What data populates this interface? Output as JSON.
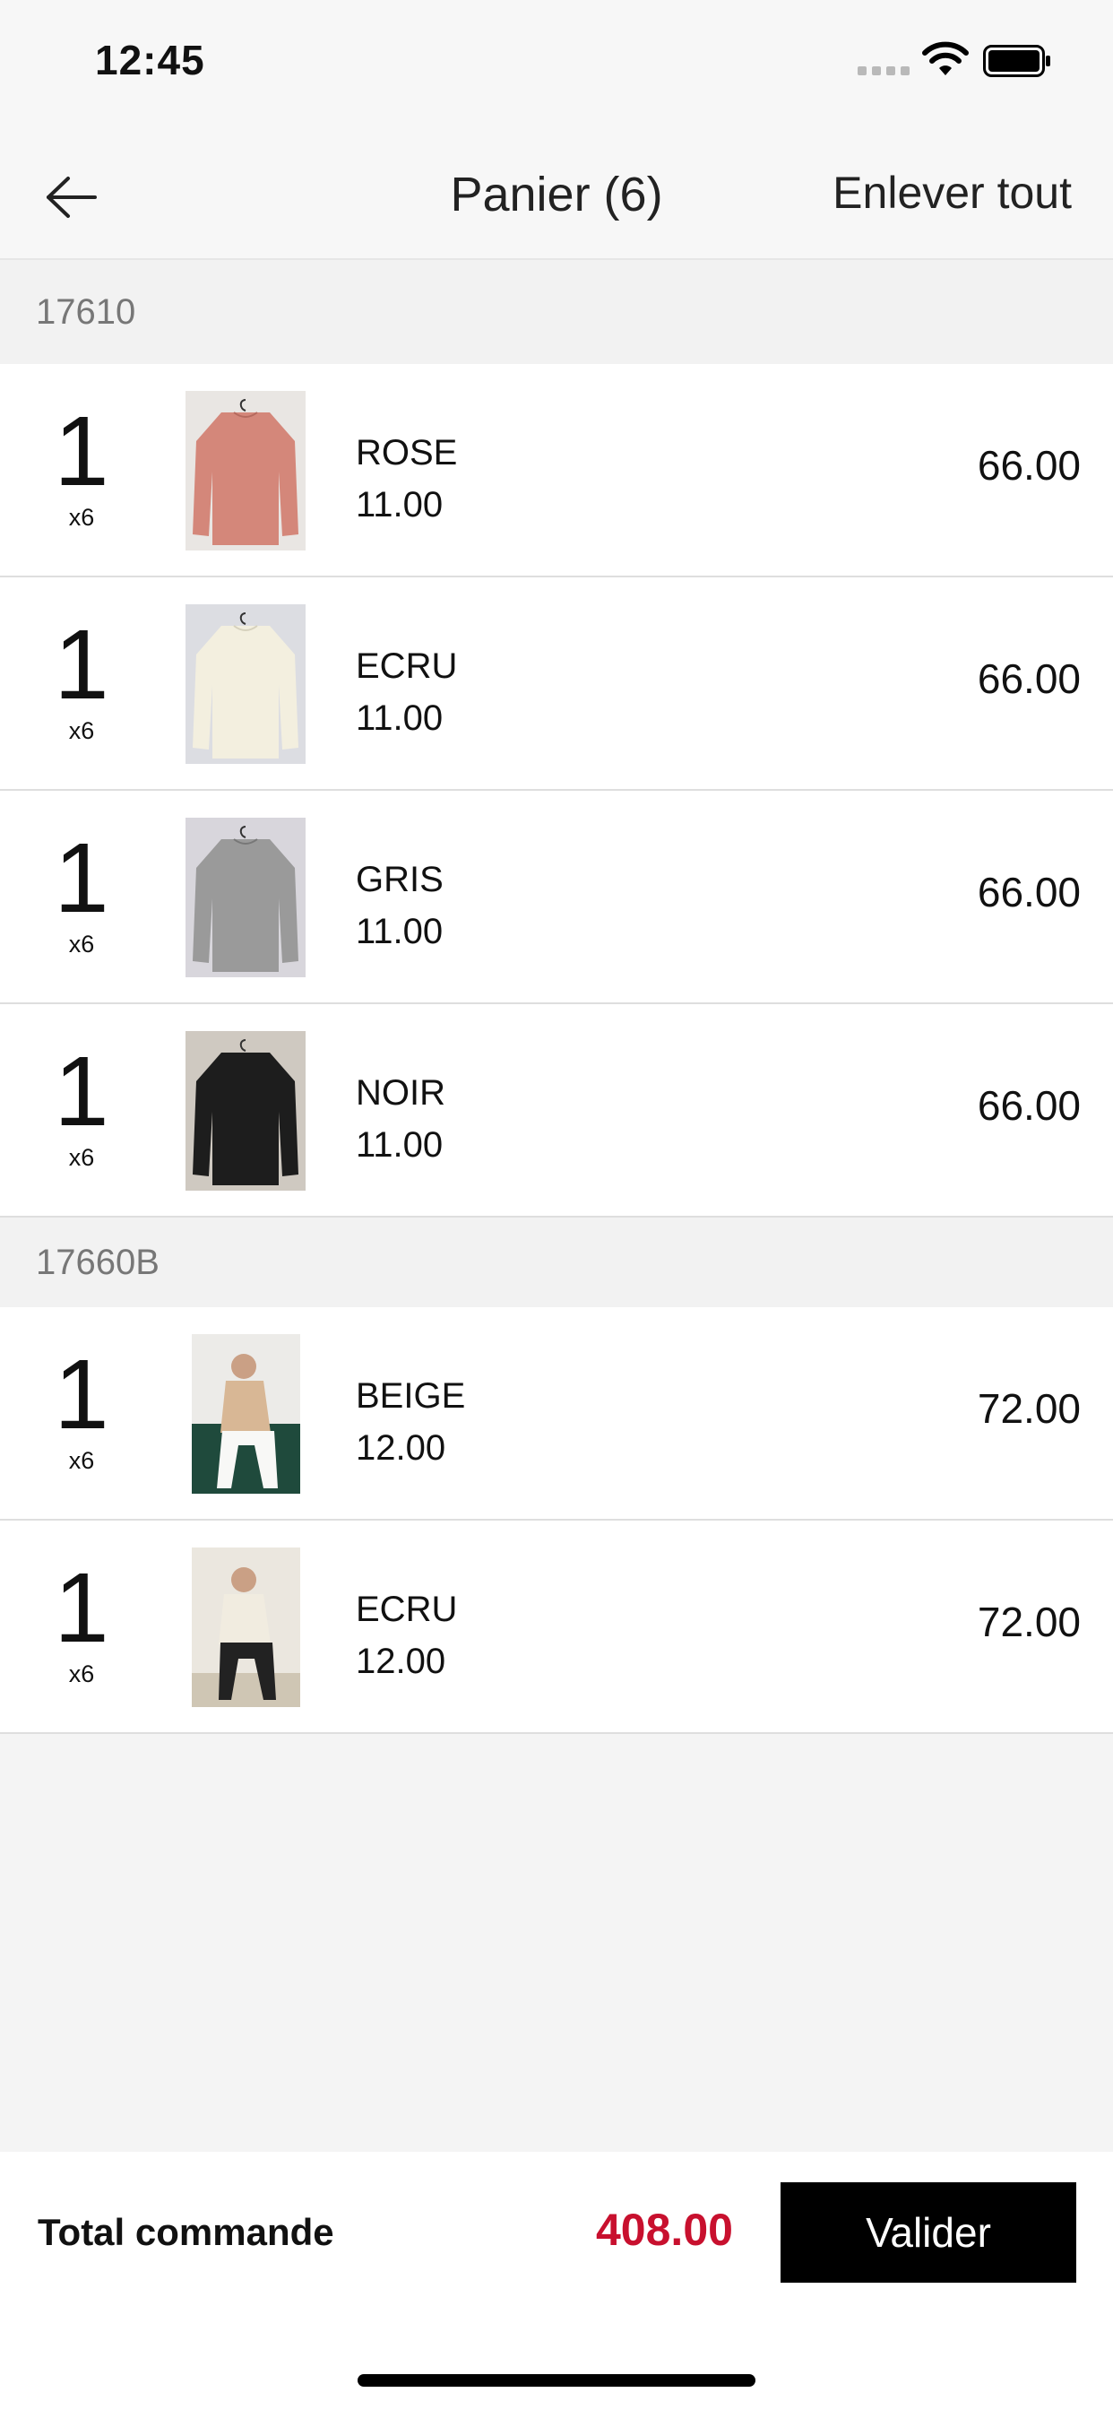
{
  "status_bar": {
    "time": "12:45"
  },
  "nav": {
    "title": "Panier (6)",
    "action_label": "Enlever tout"
  },
  "groups": [
    {
      "ref": "17610",
      "items": [
        {
          "qty": "1",
          "multiplier": "x6",
          "color_name": "ROSE",
          "unit_price": "11.00",
          "line_total": "66.00",
          "swatch": "#d4877a"
        },
        {
          "qty": "1",
          "multiplier": "x6",
          "color_name": "ECRU",
          "unit_price": "11.00",
          "line_total": "66.00",
          "swatch": "#f3efdf"
        },
        {
          "qty": "1",
          "multiplier": "x6",
          "color_name": "GRIS",
          "unit_price": "11.00",
          "line_total": "66.00",
          "swatch": "#9a9a9a"
        },
        {
          "qty": "1",
          "multiplier": "x6",
          "color_name": "NOIR",
          "unit_price": "11.00",
          "line_total": "66.00",
          "swatch": "#1d1d1d"
        }
      ]
    },
    {
      "ref": "17660B",
      "items": [
        {
          "qty": "1",
          "multiplier": "x6",
          "color_name": "BEIGE",
          "unit_price": "12.00",
          "line_total": "72.00",
          "swatch": "#d8b795"
        },
        {
          "qty": "1",
          "multiplier": "x6",
          "color_name": "ECRU",
          "unit_price": "12.00",
          "line_total": "72.00",
          "swatch": "#f1ece0"
        }
      ]
    }
  ],
  "footer": {
    "total_label": "Total commande",
    "total_value": "408.00",
    "validate_label": "Valider"
  },
  "colors": {
    "accent_total": "#c8102e",
    "button_bg": "#000000"
  }
}
